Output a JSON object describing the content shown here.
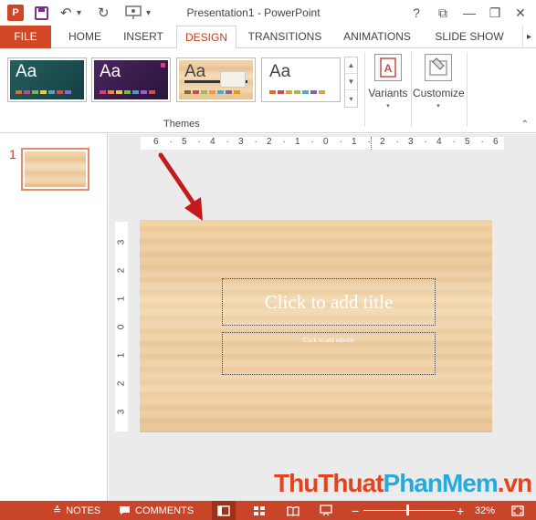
{
  "app": {
    "logo": "P",
    "title": "Presentation1 - PowerPoint",
    "quick_access": {
      "undo": "↶",
      "dropdown": "▾",
      "redo": "↻"
    },
    "window_buttons": {
      "help": "?",
      "ribbon_display": "⧉",
      "minimize": "—",
      "restore": "❐",
      "close": "✕"
    }
  },
  "tabs": [
    "FILE",
    "HOME",
    "INSERT",
    "DESIGN",
    "TRANSITIONS",
    "ANIMATIONS",
    "SLIDE SHOW"
  ],
  "active_tab": "DESIGN",
  "ribbon": {
    "themes": [
      {
        "name": "theme-1",
        "label": "Aa",
        "bg": "#1f5f5b",
        "fg": "#ffffff"
      },
      {
        "name": "theme-2",
        "label": "Aa",
        "bg": "#3b1e4d",
        "fg": "#ffffff"
      },
      {
        "name": "theme-3",
        "label": "Aa",
        "bg": "#e8c79b",
        "fg": "#444444"
      },
      {
        "name": "theme-4",
        "label": "Aa",
        "bg": "#ffffff",
        "fg": "#444444"
      }
    ],
    "gallery_scroll": {
      "up": "▲",
      "down": "▼",
      "more": "▾"
    },
    "group_themes": "Themes",
    "variants": "Variants",
    "customize": "Customize",
    "caret": "▾",
    "collapse": "⌃"
  },
  "slide_panel": {
    "slide_number": "1"
  },
  "ruler": {
    "horizontal": [
      "6",
      "5",
      "4",
      "3",
      "2",
      "1",
      "0",
      "1",
      "2",
      "3",
      "4",
      "5",
      "6"
    ],
    "vertical": [
      "3",
      "2",
      "1",
      "0",
      "1",
      "2",
      "3"
    ]
  },
  "slide": {
    "title_placeholder": "Click to add title",
    "subtitle_placeholder": "Click to add subtitle"
  },
  "watermark": {
    "part1": "ThuThuat",
    "part2": "PhanMem",
    "part3": ".vn",
    "colors": {
      "part1": "#e0451f",
      "part2": "#27a9d9",
      "part3": "#e0451f"
    }
  },
  "statusbar": {
    "notes": "NOTES",
    "comments": "COMMENTS",
    "zoom_minus": "−",
    "zoom_plus": "+",
    "zoom": "32%",
    "zoom_level_fraction": 0.32
  },
  "colors": {
    "accent": "#c43e1c",
    "status_bg": "#c8452a",
    "arrow": "#c41a1a"
  }
}
